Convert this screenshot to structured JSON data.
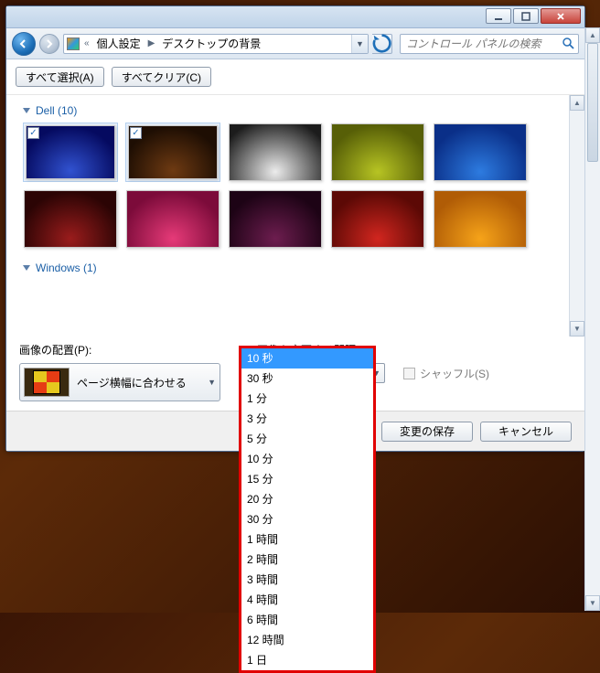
{
  "titlebar": {
    "minimize": "minimize",
    "maximize": "maximize",
    "close": "close"
  },
  "nav": {
    "back": "back",
    "forward": "forward",
    "prefix": "«",
    "crumb1": "個人設定",
    "crumb2": "デスクトップの背景",
    "refresh": "↻"
  },
  "search": {
    "placeholder": "コントロール パネルの検索"
  },
  "toolbar": {
    "select_all": "すべて選択(A)",
    "clear_all": "すべてクリア(C)"
  },
  "groups": {
    "dell": "Dell (10)",
    "windows": "Windows (1)"
  },
  "settings": {
    "position_label": "画像の配置(P):",
    "position_value": "ページ横幅に合わせる",
    "interval_label": "画像を変更する間隔(N):",
    "interval_value": "10 秒",
    "shuffle_label": "シャッフル(S)"
  },
  "interval_options": [
    "10 秒",
    "30 秒",
    "1 分",
    "3 分",
    "5 分",
    "10 分",
    "15 分",
    "20 分",
    "30 分",
    "1 時間",
    "2 時間",
    "3 時間",
    "4 時間",
    "6 時間",
    "12 時間",
    "1 日"
  ],
  "footer": {
    "save": "変更の保存",
    "cancel": "キャンセル"
  },
  "wallpapers": [
    {
      "class": "sw-blue",
      "checked": true
    },
    {
      "class": "sw-brown",
      "checked": true
    },
    {
      "class": "sw-grey",
      "checked": false
    },
    {
      "class": "sw-olive",
      "checked": false
    },
    {
      "class": "sw-blue2",
      "checked": false
    },
    {
      "class": "sw-dred",
      "checked": false
    },
    {
      "class": "sw-pink",
      "checked": false
    },
    {
      "class": "sw-purp",
      "checked": false
    },
    {
      "class": "sw-red",
      "checked": false
    },
    {
      "class": "sw-orng",
      "checked": false
    }
  ]
}
